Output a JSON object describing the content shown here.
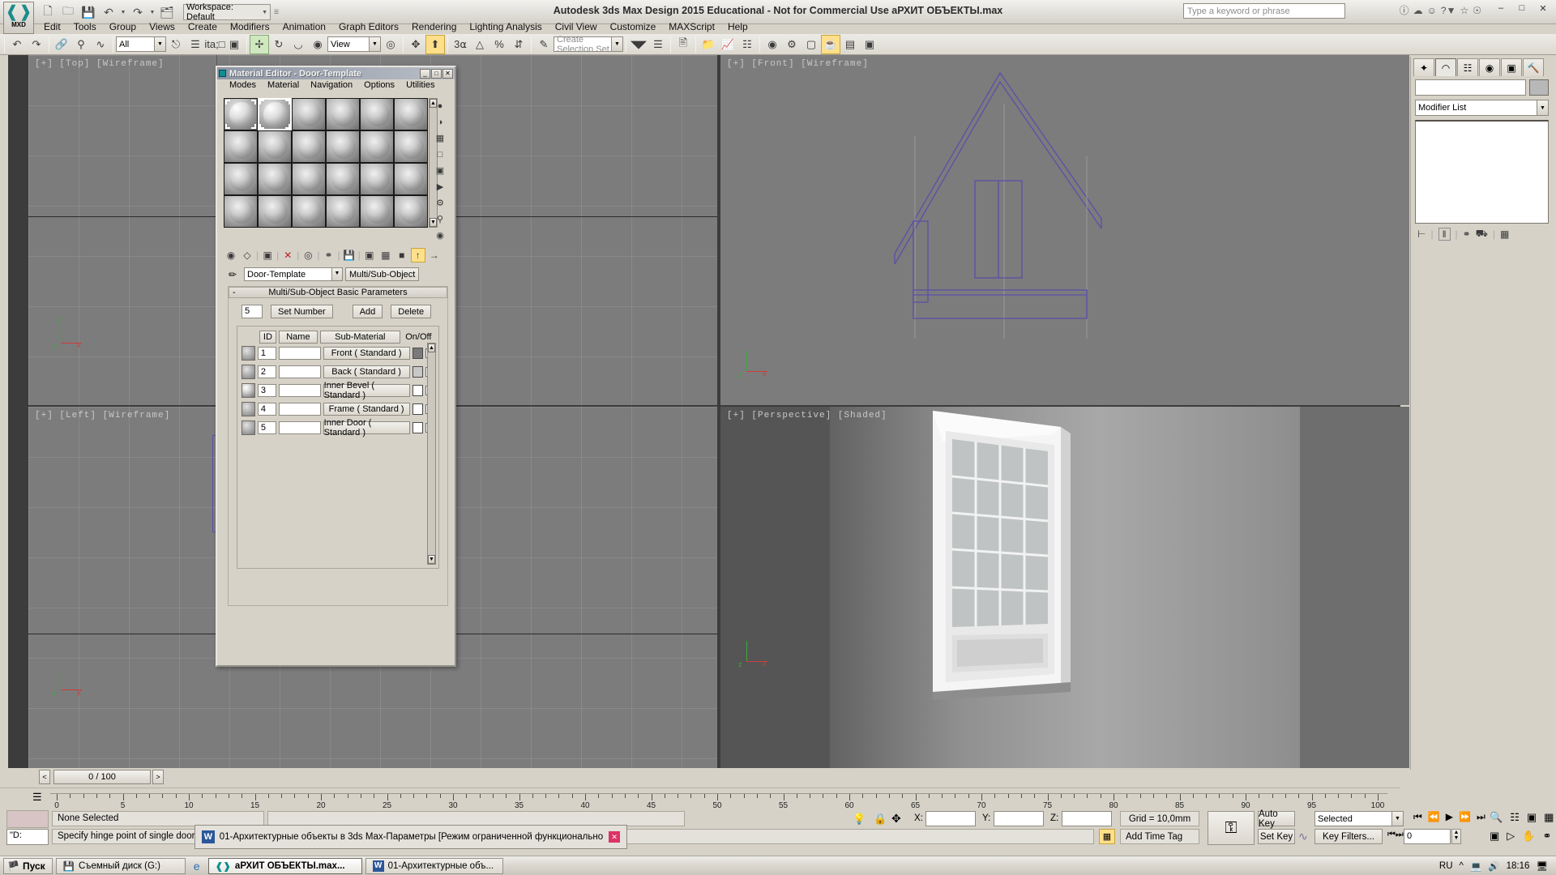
{
  "app": {
    "title": "Autodesk 3ds Max Design 2015  Educational - Not for Commercial Use    аРХИТ ОБЪЕКТЫ.max",
    "logo_label": "MXD",
    "workspace": "Workspace: Default",
    "search_placeholder": "Type a keyword or phrase"
  },
  "menu": {
    "items": [
      "Edit",
      "Tools",
      "Group",
      "Views",
      "Create",
      "Modifiers",
      "Animation",
      "Graph Editors",
      "Rendering",
      "Lighting Analysis",
      "Civil View",
      "Customize",
      "MAXScript",
      "Help"
    ]
  },
  "toolbar": {
    "selection_filter": "All",
    "reference_coord": "View",
    "selection_set_placeholder": "Create Selection Set",
    "icons": [
      "undo-icon",
      "redo-icon",
      "select-link-icon",
      "unlink-icon",
      "bind-space-warp-icon",
      "select-object-icon",
      "select-by-name-icon",
      "rect-selection-region-icon",
      "window-crossing-icon",
      "select-and-move-icon",
      "select-and-rotate-icon",
      "select-and-scale-icon",
      "select-and-place-icon",
      "use-pivot-center-icon",
      "select-and-manipulate-icon",
      "snaps-toggle-icon",
      "angle-snap-icon",
      "percent-snap-icon",
      "spinner-snap-icon",
      "named-selection-sets-icon",
      "mirror-icon",
      "align-icon",
      "layer-manager-icon",
      "toggle-scene-explorer-icon",
      "curve-editor-icon",
      "schematic-view-icon",
      "material-editor-icon",
      "render-setup-icon",
      "render-frame-icon",
      "render-production-icon"
    ]
  },
  "viewports": [
    {
      "name": "top",
      "label": "[+] [Top] [Wireframe]"
    },
    {
      "name": "front",
      "label": "[+] [Front] [Wireframe]"
    },
    {
      "name": "left",
      "label": "[+] [Left] [Wireframe]"
    },
    {
      "name": "perspective",
      "label": "[+] [Perspective] [Shaded]",
      "active": true
    }
  ],
  "command_panel": {
    "tabs": [
      "create-tab",
      "modify-tab",
      "hierarchy-tab",
      "motion-tab",
      "display-tab",
      "utilities-tab"
    ],
    "selected_tab_index": 1,
    "object_name": "",
    "modifier_list": "Modifier List",
    "stack_buttons": [
      "pin-stack-icon",
      "show-end-result-icon",
      "make-unique-icon",
      "remove-modifier-icon",
      "configure-modifier-sets-icon"
    ]
  },
  "material_editor": {
    "title": "Material Editor - Door-Template",
    "menus": [
      "Modes",
      "Material",
      "Navigation",
      "Options",
      "Utilities"
    ],
    "material_name": "Door-Template",
    "material_type": "Multi/Sub-Object",
    "rollout_title": "Multi/Sub-Object Basic Parameters",
    "set_number_value": "5",
    "set_number_label": "Set Number",
    "add_label": "Add",
    "delete_label": "Delete",
    "columns": {
      "id": "ID",
      "name": "Name",
      "sub_material": "Sub-Material",
      "on_off": "On/Off"
    },
    "rows": [
      {
        "id": "1",
        "name": "",
        "sub_material": "Front  ( Standard )",
        "color": "#7a7a7a",
        "on": true,
        "noise": false
      },
      {
        "id": "2",
        "name": "",
        "sub_material": "Back  ( Standard )",
        "color": "#c8c8c8",
        "on": true,
        "noise": false
      },
      {
        "id": "3",
        "name": "",
        "sub_material": "Inner Bevel  ( Standard )",
        "color": "#ffffff",
        "on": true,
        "noise": true
      },
      {
        "id": "4",
        "name": "",
        "sub_material": "Frame  ( Standard )",
        "color": "#ffffff",
        "on": true,
        "noise": false
      },
      {
        "id": "5",
        "name": "",
        "sub_material": "Inner Door  ( Standard )",
        "color": "#ffffff",
        "on": true,
        "noise": false
      }
    ],
    "slot_count": 24,
    "selected_slot_index": 1,
    "window_buttons": [
      "minimize-button",
      "maximize-button",
      "close-button"
    ]
  },
  "timeline": {
    "current_frame_label": "0 / 100",
    "prev_frame": "<",
    "next_frame": ">",
    "ruler_labels": [
      "0",
      "5",
      "10",
      "15",
      "20",
      "25",
      "30",
      "35",
      "40",
      "45",
      "50",
      "55",
      "60",
      "65",
      "70",
      "75",
      "80",
      "85",
      "90",
      "95",
      "100"
    ]
  },
  "status_bar": {
    "selection_status": "None Selected",
    "prompt": "Specify hinge point of single door.",
    "x_label": "X:",
    "y_label": "Y:",
    "z_label": "Z:",
    "x_value": "",
    "y_value": "",
    "z_value": "",
    "grid": "Grid = 10,0mm",
    "add_time_tag": "Add Time Tag",
    "auto_key": "Auto Key",
    "set_key": "Set Key",
    "key_mode": "Selected",
    "key_filters": "Key Filters...",
    "frame_value": "0",
    "isolate_label": "\"D:"
  },
  "taskbar": {
    "start": "Пуск",
    "quick_launch": [
      "Съемный диск (G:)"
    ],
    "items": [
      {
        "label": "аРХИТ ОБЪЕКТЫ.max...",
        "icon": "3dsmax-icon",
        "active": true
      },
      {
        "label": "01-Архитектурные объ...",
        "icon": "word-icon",
        "active": false
      }
    ],
    "tray": {
      "language": "RU",
      "time": "18:16"
    }
  },
  "word_popup": {
    "title": "01-Архитектурные объекты в 3ds Max-Параметры [Режим ограниченной функционально...",
    "icon": "word-icon"
  },
  "colors": {
    "accent_yellow": "#f2d93b",
    "viewport_gray": "#7c7c7c",
    "panel_gray": "#d6d2c8",
    "wire_blue": "#5b4fa8"
  }
}
